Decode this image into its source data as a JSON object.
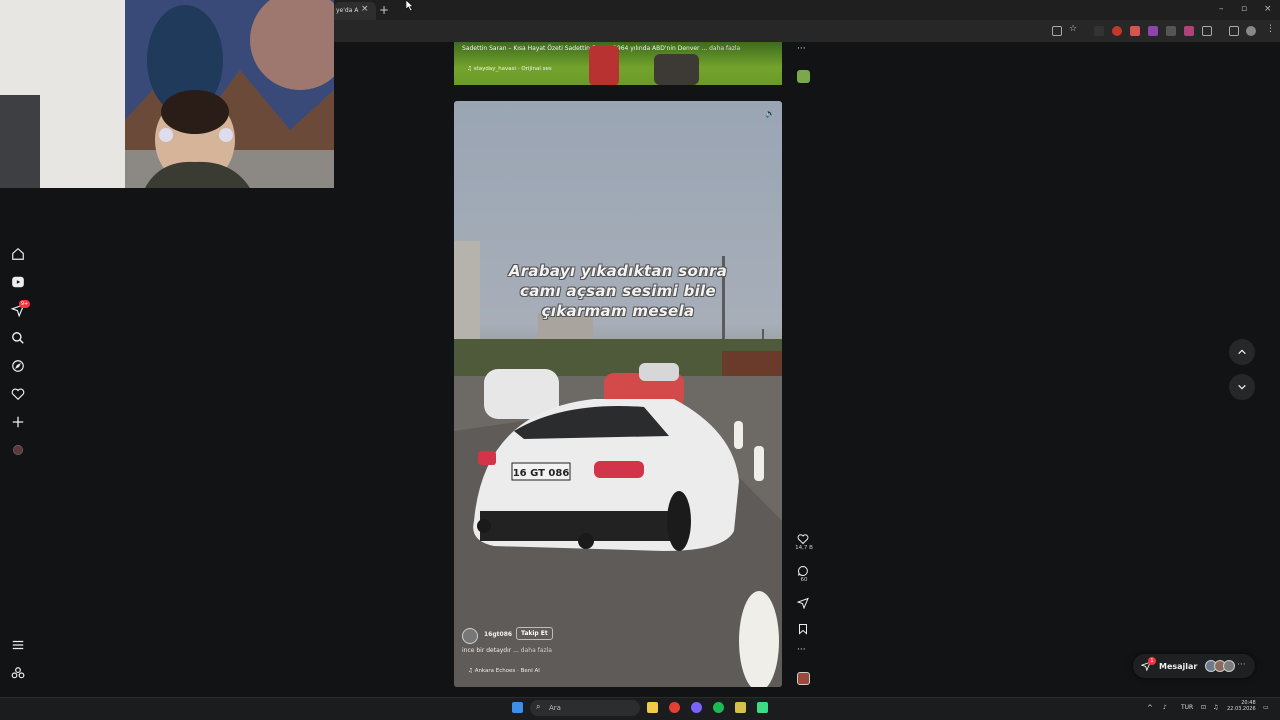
{
  "browser": {
    "tab_title": "ye'da A",
    "tab_close": "×",
    "new_tab": "+",
    "window_controls": [
      "–",
      "▫",
      "×"
    ]
  },
  "feed": {
    "prev_reel": {
      "caption": "Sadettin Saran – Kısa Hayat Özeti Sadettin Saran, 1964 yılında ABD'nin Denver ...",
      "caption_more": "daha fazla",
      "music": "stayday_havasi · Orijinal ses"
    },
    "reel": {
      "overlay_lines": [
        "Arabayı yıkadıktan sonra",
        "camı açsan sesimi bile",
        "çıkarmam mesela"
      ],
      "username": "16gt086",
      "follow_label": "Takip Et",
      "description": "ince bir detaydır ...",
      "description_more": "daha fazla",
      "music": "Ankara Echoes · Beni Al"
    },
    "actions": {
      "likes": "14,7 B",
      "comments": "60"
    }
  },
  "nav": {
    "notifications_badge": "9+",
    "items": [
      "home-icon",
      "reels-icon",
      "direct-icon",
      "search-icon",
      "explore-icon",
      "heart-icon",
      "plus-icon",
      "profile-avatar",
      "menu-icon",
      "threads-icon"
    ]
  },
  "messages": {
    "label": "Mesajlar",
    "badge": "1"
  },
  "taskbar": {
    "search_placeholder": "Ara",
    "language": "TUR",
    "time": "20:48",
    "date": "22.03.2026"
  },
  "colors": {
    "accent_badge": "#ff3040",
    "background": "#121314"
  }
}
